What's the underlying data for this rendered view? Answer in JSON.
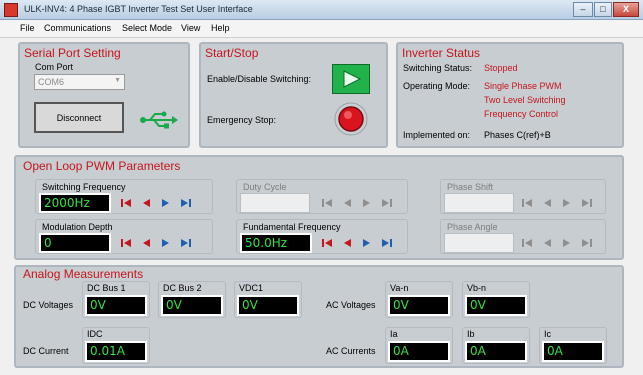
{
  "window": {
    "title": "ULK-INV4: 4 Phase IGBT Inverter Test Set User Interface",
    "min_label": "–",
    "max_label": "□",
    "close_label": "X"
  },
  "menu": {
    "file": "File",
    "communications": "Communications",
    "select_mode": "Select Mode",
    "view": "View",
    "help": "Help"
  },
  "serial": {
    "title": "Serial Port Setting",
    "com_port_label": "Com Port",
    "com_port_value": "COM6",
    "disconnect_label": "Disconnect"
  },
  "startstop": {
    "title": "Start/Stop",
    "enable_label": "Enable/Disable Switching:",
    "estop_label": "Emergency Stop:"
  },
  "status": {
    "title": "Inverter Status",
    "switching_label": "Switching Status:",
    "switching_value": "Stopped",
    "mode_label": "Operating Mode:",
    "mode_line1": "Single Phase PWM",
    "mode_line2": "Two Level Switching",
    "mode_line3": "Frequency Control",
    "implemented_label": "Implemented on:",
    "implemented_value": "Phases C(ref)+B"
  },
  "pwm": {
    "title": "Open Loop PWM Parameters",
    "switching_frequency_label": "Switching Frequency",
    "switching_frequency_value": "2000Hz",
    "duty_cycle_label": "Duty Cycle",
    "phase_shift_label": "Phase Shift",
    "modulation_depth_label": "Modulation Depth",
    "modulation_depth_value": "0",
    "fundamental_frequency_label": "Fundamental Frequency",
    "fundamental_frequency_value": "50.0Hz",
    "phase_angle_label": "Phase Angle"
  },
  "analog": {
    "title": "Analog Measurements",
    "dc_voltages_label": "DC Voltages",
    "dc_current_label": "DC Current",
    "ac_voltages_label": "AC Voltages",
    "ac_currents_label": "AC Currents",
    "dc_bus1_label": "DC Bus 1",
    "dc_bus1_value": "0V",
    "dc_bus2_label": "DC Bus 2",
    "dc_bus2_value": "0V",
    "vdc1_label": "VDC1",
    "vdc1_value": "0V",
    "van_label": "Va-n",
    "van_value": "0V",
    "vbn_label": "Vb-n",
    "vbn_value": "0V",
    "idc_label": "IDC",
    "idc_value": "0.01A",
    "ia_label": "Ia",
    "ia_value": "0A",
    "ib_label": "Ib",
    "ib_value": "0A",
    "ic_label": "Ic",
    "ic_value": "0A"
  },
  "colors": {
    "title_red": "#c4161c",
    "panel_grey": "#c8cdd2",
    "display_green": "#35e045",
    "start_green": "#22b24c",
    "stop_red": "#d9141e"
  },
  "icons": [
    "app-icon",
    "usb-icon",
    "play-icon",
    "emergency-stop-icon",
    "skip-back-icon",
    "step-back-icon",
    "step-forward-icon",
    "skip-forward-icon"
  ]
}
